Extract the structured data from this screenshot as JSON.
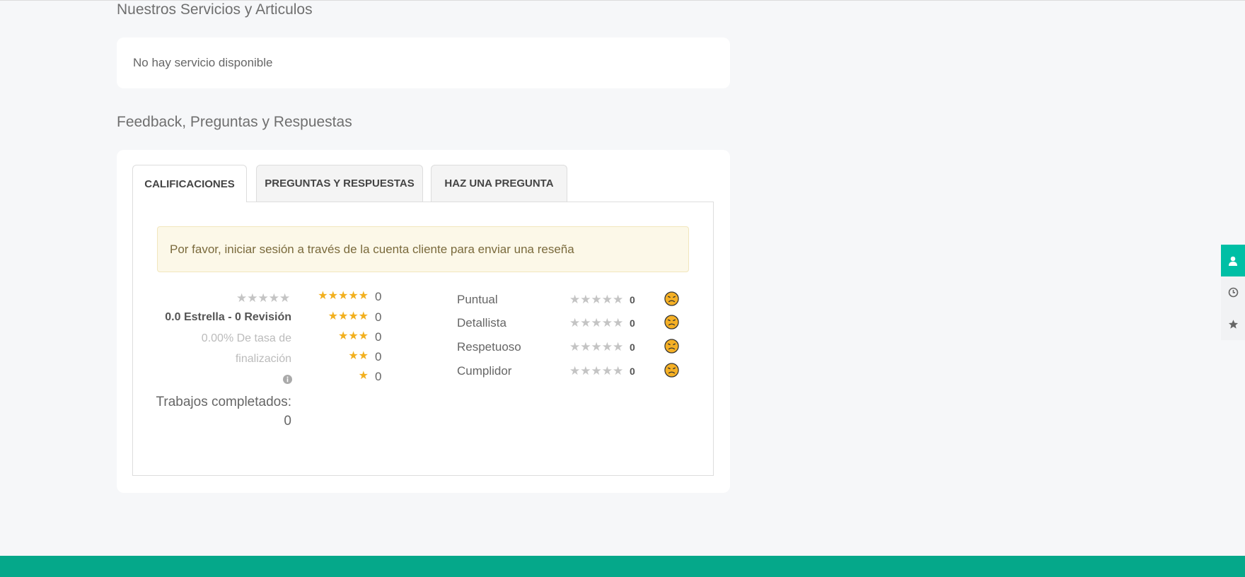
{
  "sections": {
    "services_title": "Nuestros Servicios y Articulos",
    "no_service": "No hay servicio disponible",
    "feedback_title": "Feedback, Preguntas y Respuestas"
  },
  "tabs": [
    {
      "label": "CALIFICACIONES",
      "active": true
    },
    {
      "label": "PREGUNTAS Y RESPUESTAS",
      "active": false
    },
    {
      "label": "HAZ UNA PREGUNTA",
      "active": false
    }
  ],
  "alert": "Por favor, iniciar sesión a través de la cuenta cliente para enviar una reseña",
  "summary": {
    "stars": "★★★★★",
    "rating_text": "0.0 Estrella - 0 Revisión",
    "completion_line1": "0.00% De tasa de",
    "completion_line2": "finalización",
    "jobs_label": "Trabajos completados:",
    "jobs_value": "0"
  },
  "breakdown": [
    {
      "stars": "★★★★★",
      "count": "0"
    },
    {
      "stars": "★★★★",
      "count": "0"
    },
    {
      "stars": "★★★",
      "count": "0"
    },
    {
      "stars": "★★",
      "count": "0"
    },
    {
      "stars": "★",
      "count": "0"
    }
  ],
  "criteria": [
    {
      "label": "Puntual",
      "stars": "★★★★★",
      "value": "0"
    },
    {
      "label": "Detallista",
      "stars": "★★★★★",
      "value": "0"
    },
    {
      "label": "Respetuoso",
      "stars": "★★★★★",
      "value": "0"
    },
    {
      "label": "Cumplidor",
      "stars": "★★★★★",
      "value": "0"
    }
  ],
  "icons": {
    "sidebar": [
      "user-icon",
      "clock-icon",
      "star-icon"
    ],
    "info": "info-icon",
    "face": "angry-face-icon"
  },
  "colors": {
    "accent": "#00bfa5",
    "footer": "#05a88a",
    "star": "#f2b01e",
    "star_empty": "#c4c4c4",
    "alert_bg": "#fcf8e8"
  }
}
